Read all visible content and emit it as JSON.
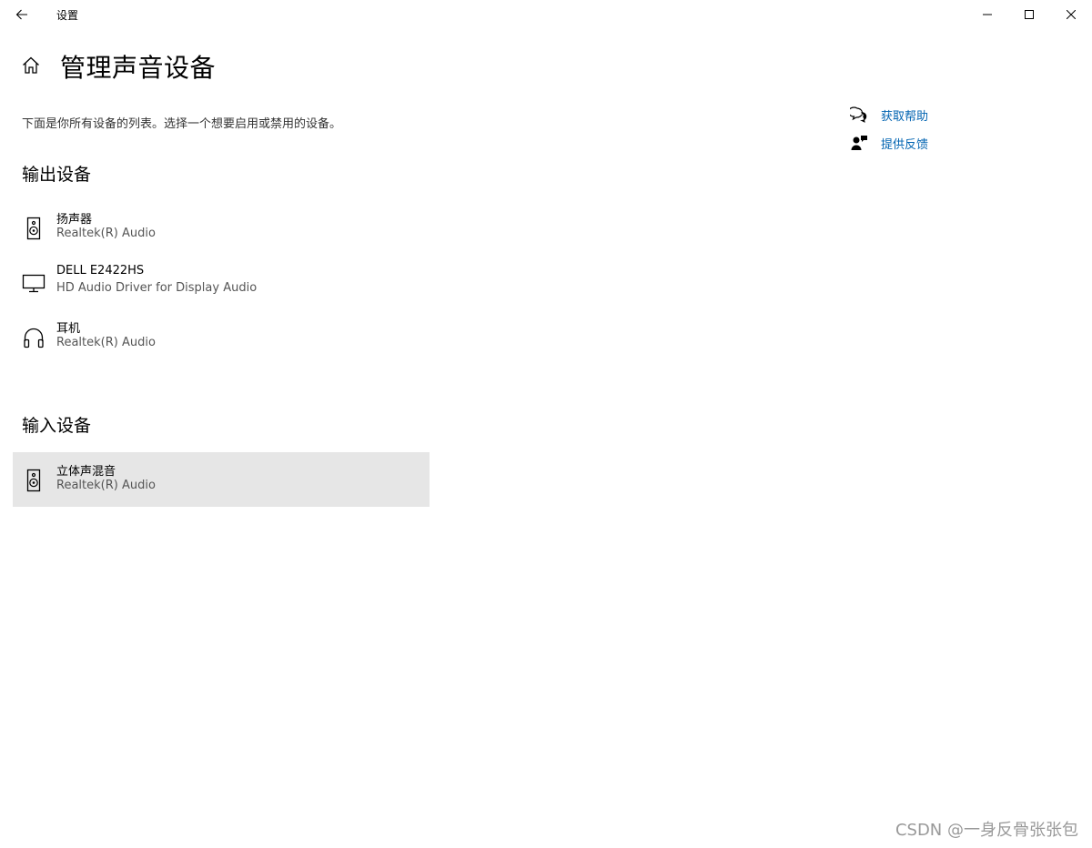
{
  "window": {
    "title": "设置"
  },
  "page": {
    "title": "管理声音设备",
    "description": "下面是你所有设备的列表。选择一个想要启用或禁用的设备。"
  },
  "output_section": {
    "heading": "输出设备",
    "devices": [
      {
        "name": "扬声器",
        "driver": "Realtek(R) Audio",
        "icon": "speaker-icon"
      },
      {
        "name": "DELL E2422HS",
        "driver": "HD Audio Driver for Display Audio",
        "icon": "monitor-icon"
      },
      {
        "name": "耳机",
        "driver": "Realtek(R) Audio",
        "icon": "headphones-icon"
      }
    ]
  },
  "input_section": {
    "heading": "输入设备",
    "devices": [
      {
        "name": "立体声混音",
        "driver": "Realtek(R) Audio",
        "icon": "speaker-icon",
        "selected": true
      }
    ]
  },
  "help": {
    "get_help": "获取帮助",
    "feedback": "提供反馈"
  },
  "watermark": "CSDN @一身反骨张张包",
  "colors": {
    "link": "#0063b1",
    "selected_bg": "#e6e6e6"
  }
}
